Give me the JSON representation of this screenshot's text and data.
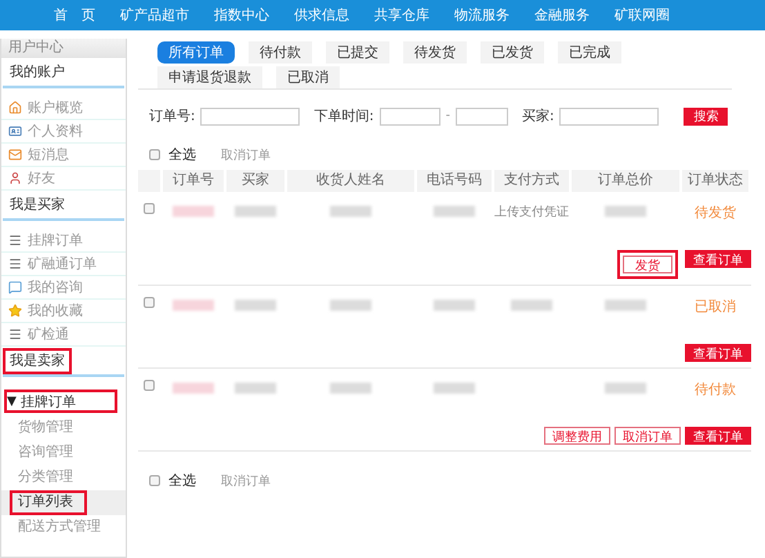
{
  "nav": [
    "首　页",
    "矿产品超市",
    "指数中心",
    "供求信息",
    "共享仓库",
    "物流服务",
    "金融服务",
    "矿联网圈"
  ],
  "sidebar": {
    "header": "用户中心",
    "sections": [
      {
        "title": "我的账户",
        "highlighted": false,
        "items": [
          {
            "label": "账户概览",
            "kind": "house"
          },
          {
            "label": "个人资料",
            "kind": "card"
          },
          {
            "label": "短消息",
            "kind": "mail"
          },
          {
            "label": "好友",
            "kind": "person"
          }
        ]
      },
      {
        "title": "我是买家",
        "highlighted": false,
        "items": [
          {
            "label": "挂牌订单",
            "kind": "menu"
          },
          {
            "label": "矿融通订单",
            "kind": "menu"
          },
          {
            "label": "我的咨询",
            "kind": "chat"
          },
          {
            "label": "我的收藏",
            "kind": "star"
          },
          {
            "label": "矿检通",
            "kind": "menu"
          }
        ]
      },
      {
        "title": "我是卖家",
        "highlighted": true,
        "groups": [
          {
            "label": "挂牌订单",
            "toggle": "▼",
            "expanded": true,
            "highlighted": true,
            "children": [
              {
                "label": "货物管理",
                "selected": false,
                "highlighted": false
              },
              {
                "label": "咨询管理",
                "selected": false,
                "highlighted": false
              },
              {
                "label": "分类管理",
                "selected": false,
                "highlighted": false
              },
              {
                "label": "订单列表",
                "selected": true,
                "highlighted": true
              },
              {
                "label": "配送方式管理",
                "selected": false,
                "highlighted": false
              }
            ]
          }
        ]
      }
    ]
  },
  "tabs": [
    {
      "label": "所有订单",
      "selected": true
    },
    {
      "label": "待付款",
      "selected": false
    },
    {
      "label": "已提交",
      "selected": false
    },
    {
      "label": "待发货",
      "selected": false
    },
    {
      "label": "已发货",
      "selected": false
    },
    {
      "label": "已完成",
      "selected": false
    },
    {
      "label": "申请退货退款",
      "selected": false
    },
    {
      "label": "已取消",
      "selected": false
    }
  ],
  "filters": {
    "fields": [
      {
        "label": "订单号:",
        "kind": "text"
      },
      {
        "label": "下单时间:",
        "kind": "range",
        "separator": "-"
      },
      {
        "label": "买家:",
        "kind": "text"
      }
    ],
    "search_button": "搜索"
  },
  "bulk_top": {
    "select_all": "全选",
    "checked": false,
    "cancel": "取消订单"
  },
  "table": {
    "columns": [
      "订单号",
      "买家",
      "收货人姓名",
      "电话号码",
      "支付方式",
      "订单总价",
      "订单状态"
    ],
    "rows": [
      {
        "checked": false,
        "cells": [
          {
            "kind": "redacted"
          },
          {
            "kind": "redacted"
          },
          {
            "kind": "redacted"
          },
          {
            "kind": "redacted"
          },
          {
            "kind": "text",
            "text": "上传支付凭证"
          },
          {
            "kind": "redacted"
          }
        ],
        "status": "待发货",
        "actions": [
          {
            "label": "发货",
            "kind": "outline",
            "highlighted": true
          },
          {
            "label": "查看订单",
            "kind": "filled",
            "highlighted": false
          }
        ]
      },
      {
        "checked": false,
        "cells": [
          {
            "kind": "redacted"
          },
          {
            "kind": "redacted"
          },
          {
            "kind": "redacted"
          },
          {
            "kind": "redacted"
          },
          {
            "kind": "redacted"
          },
          {
            "kind": "redacted"
          }
        ],
        "status": "已取消",
        "actions": [
          {
            "label": "查看订单",
            "kind": "filled",
            "highlighted": false
          }
        ]
      },
      {
        "checked": false,
        "cells": [
          {
            "kind": "redacted"
          },
          {
            "kind": "redacted"
          },
          {
            "kind": "redacted"
          },
          {
            "kind": "redacted"
          },
          {
            "kind": "empty"
          },
          {
            "kind": "redacted"
          }
        ],
        "status": "待付款",
        "actions": [
          {
            "label": "调整费用",
            "kind": "outline",
            "highlighted": false
          },
          {
            "label": "取消订单",
            "kind": "outline",
            "highlighted": false
          },
          {
            "label": "查看订单",
            "kind": "filled",
            "highlighted": false
          }
        ]
      }
    ]
  },
  "bulk_bottom": {
    "select_all": "全选",
    "checked": false,
    "cancel": "取消订单"
  }
}
